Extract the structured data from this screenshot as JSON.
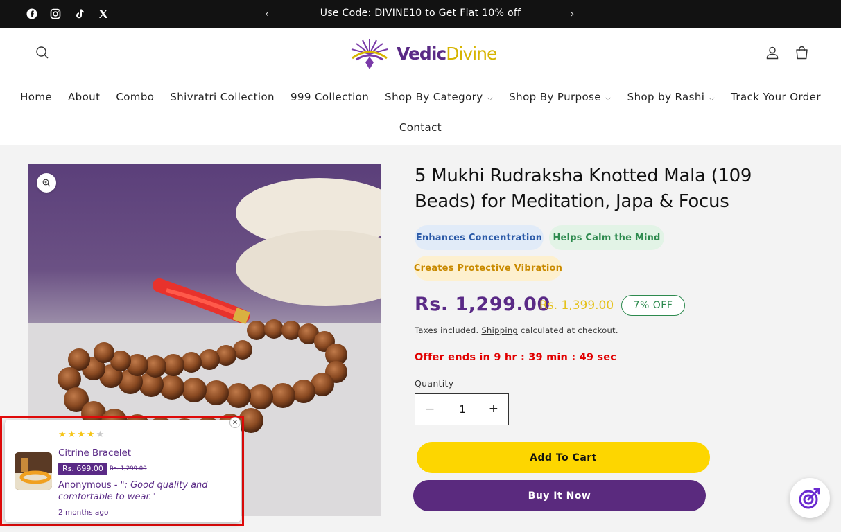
{
  "topbar": {
    "social_icons": [
      "facebook-icon",
      "instagram-icon",
      "tiktok-icon",
      "x-icon"
    ],
    "announcement": "Use Code: DIVINE10 to Get Flat 10% off",
    "prev": "‹",
    "next": "›"
  },
  "header": {
    "logo_part1": "Vedic",
    "logo_part2": "Divine",
    "nav": [
      "Home",
      "About",
      "Combo",
      "Shivratri Collection",
      "999 Collection",
      "Shop By Category",
      "Shop By Purpose",
      "Shop by Rashi",
      "Track Your Order"
    ],
    "nav_second_row": "Contact"
  },
  "product": {
    "title": "5 Mukhi Rudraksha Knotted Mala (109 Beads) for Meditation, Japa & Focus",
    "benefits": [
      {
        "label": "Enhances Concentration",
        "color": "#2b5aa8",
        "bg": "#e1ebf8"
      },
      {
        "label": "Helps Calm the Mind",
        "color": "#2d8a4e",
        "bg": "#e2f3e6"
      },
      {
        "label": "Creates Protective Vibration",
        "color": "#c98a00",
        "bg": "#fdf0cf"
      }
    ],
    "price": "Rs. 1,299.00",
    "compare_price": "Rs. 1,399.00",
    "discount": "7% OFF",
    "taxes_pre": "Taxes included.",
    "shipping": "Shipping",
    "taxes_post": "calculated at checkout.",
    "offer": "Offer ends in 9 hr : 39 min : 49 sec",
    "quantity_label": "Quantity",
    "quantity": "1",
    "add_to_cart": "Add To Cart",
    "buy_now": "Buy It Now"
  },
  "review_popup": {
    "rating": 4,
    "rating_max": 5,
    "product": "Citrine Bracelet",
    "price": "Rs. 699.00",
    "compare_price": "Rs. 1,299.00",
    "author": "Anonymous",
    "text": "- \": Good quality and comfortable to wear.\"",
    "time": "2 months ago"
  },
  "colors": {
    "brand_purple": "#5a2a86",
    "brand_yellow": "#fdd600",
    "offer_red": "#e10000",
    "discount_green": "#2d8a4e"
  }
}
